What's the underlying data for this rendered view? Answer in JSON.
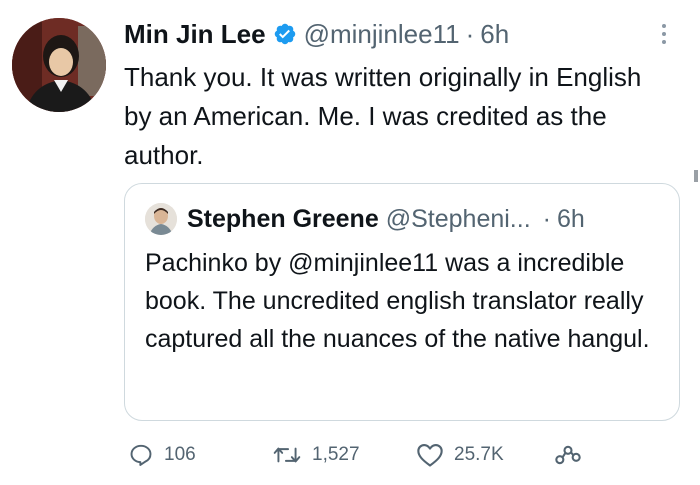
{
  "tweet": {
    "author_name": "Min Jin Lee",
    "handle": "@minjinlee11",
    "separator": "·",
    "time": "6h",
    "text": "Thank you. It was written originally in English by an American. Me. I was credited as the author.",
    "icons": {
      "verified": "verified-badge-icon",
      "more": "more-options-icon"
    },
    "colors": {
      "verified": "#1d9bf0",
      "secondary_text": "#536471",
      "primary_text": "#0f1419",
      "border": "#cfd9de"
    }
  },
  "quoted_tweet": {
    "author_name": "Stephen Greene",
    "handle": "@Stepheni...",
    "separator": "·",
    "time": "6h",
    "text": "Pachinko by @minjinlee11 was a incredible book. The uncredited english translator really captured all the nuances of the native hangul."
  },
  "actions": {
    "reply": {
      "icon": "reply-icon",
      "count": "106"
    },
    "retweet": {
      "icon": "retweet-icon",
      "count": "1,527"
    },
    "like": {
      "icon": "heart-icon",
      "count": "25.7K"
    },
    "share": {
      "icon": "share-icon"
    }
  }
}
